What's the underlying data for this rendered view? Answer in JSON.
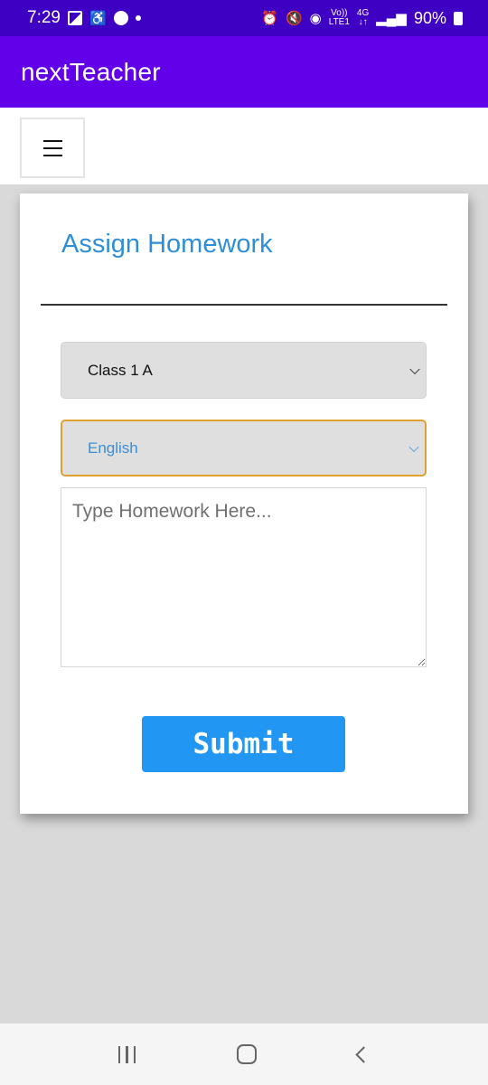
{
  "status_bar": {
    "time": "7:29",
    "left_icons": [
      "gallery-icon",
      "accessibility-icon",
      "phone-call-icon",
      "notification-dot-icon"
    ],
    "right_icons": [
      "alarm-icon",
      "mute-icon",
      "hotspot-icon",
      "volte-icon",
      "4g-icon",
      "signal-icon",
      "battery-icon"
    ],
    "volte_label_top": "Vo))",
    "volte_label_bottom": "LTE1",
    "network_label_top": "4G",
    "network_label_bottom": "↓↑",
    "battery": "90%"
  },
  "app_bar": {
    "title": "nextTeacher",
    "color": "#6200ea"
  },
  "toolbar": {
    "menu_icon": "hamburger-menu-icon"
  },
  "form": {
    "title": "Assign Homework",
    "class_select": {
      "selected": "Class 1 A"
    },
    "subject_select": {
      "selected": "English",
      "focused": true
    },
    "homework_textarea": {
      "value": "",
      "placeholder": "Type Homework Here..."
    },
    "submit_label": "Submit",
    "accent_color": "#2196f3",
    "title_color": "#2e8fd8",
    "focus_border_color": "#e0a030"
  },
  "nav_bar": {
    "buttons": [
      "recent-apps",
      "home",
      "back"
    ]
  }
}
